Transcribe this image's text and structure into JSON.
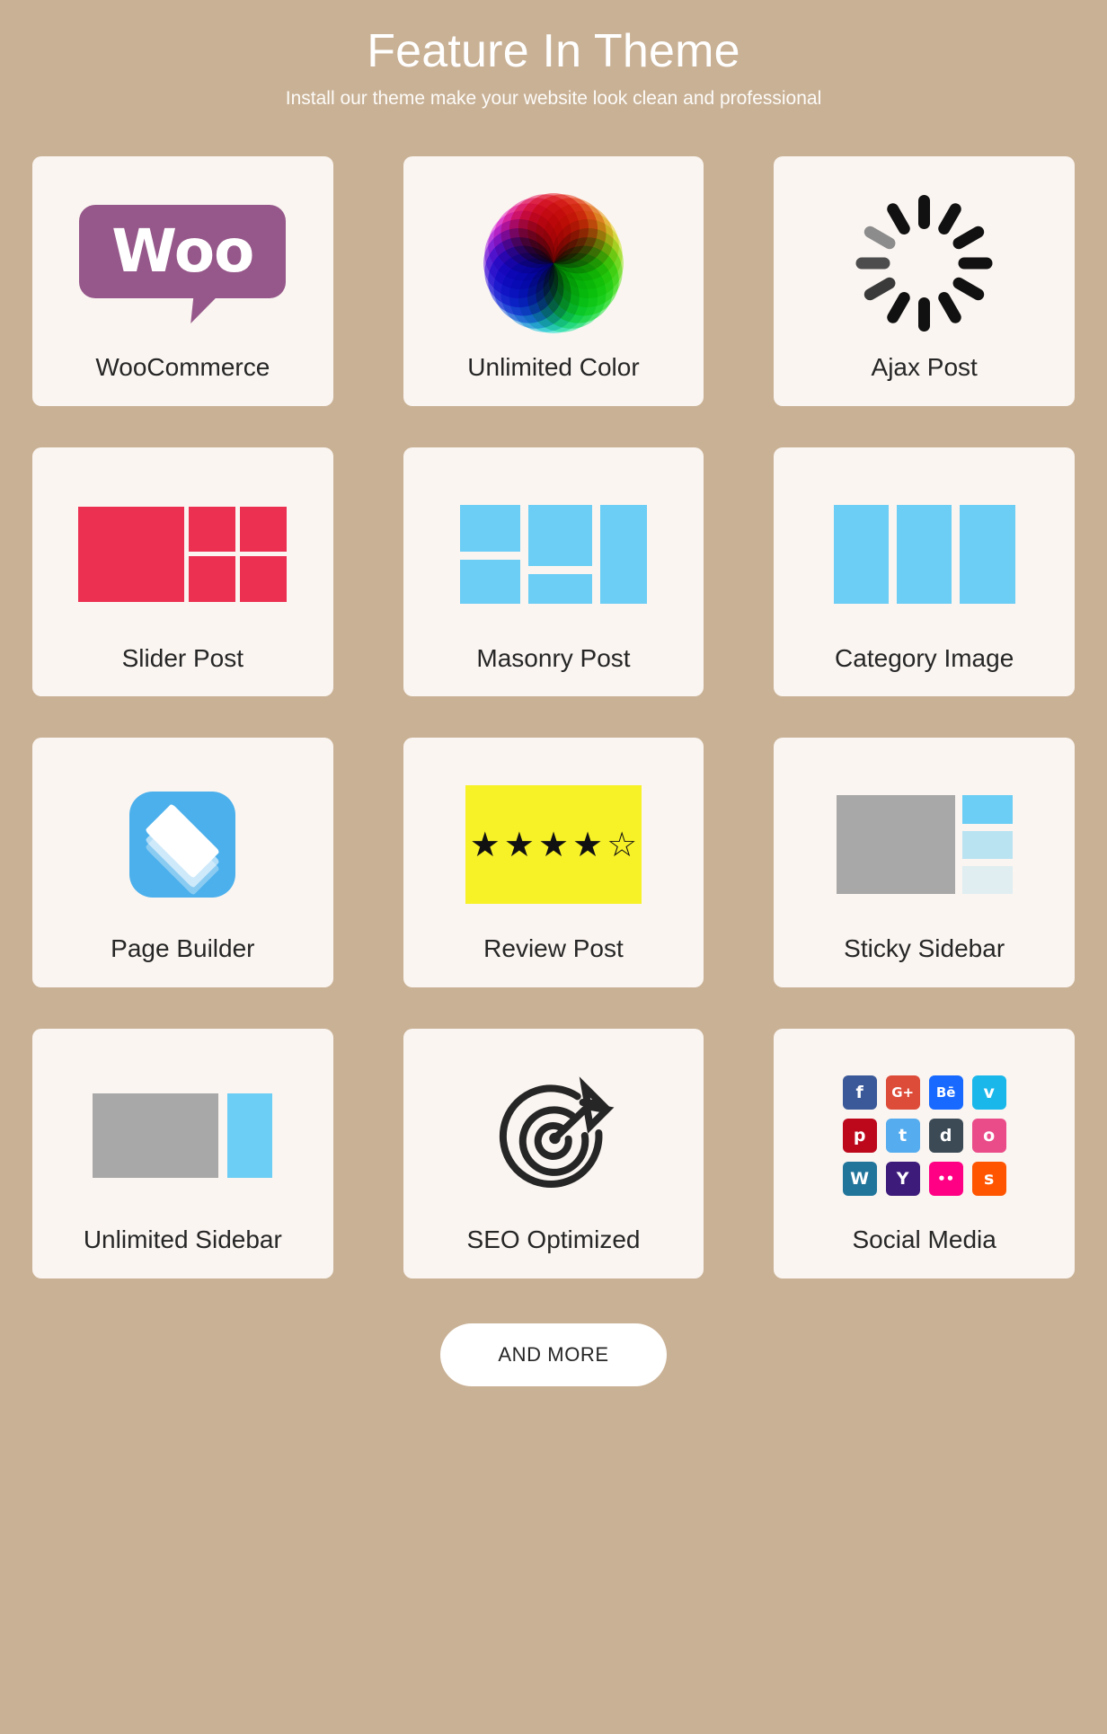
{
  "header": {
    "title": "Feature In Theme",
    "subtitle": "Install our theme make your website look clean and professional"
  },
  "theme": {
    "background": "#c9b195",
    "card_background": "#faf5f1",
    "title_color": "#ffffff",
    "label_color": "#262626",
    "accent_red": "#ec3052",
    "accent_blue": "#6ccef5",
    "accent_gray": "#a8a8a8",
    "accent_yellow": "#f7f128",
    "woo_purple": "#96588a",
    "page_builder_blue": "#4cb0ec"
  },
  "features": [
    {
      "label": "WooCommerce",
      "icon": "woocommerce-logo-icon",
      "woo_text": "Woo"
    },
    {
      "label": "Unlimited Color",
      "icon": "color-wheel-icon"
    },
    {
      "label": "Ajax Post",
      "icon": "loading-spinner-icon"
    },
    {
      "label": "Slider Post",
      "icon": "slider-layout-icon"
    },
    {
      "label": "Masonry Post",
      "icon": "masonry-layout-icon"
    },
    {
      "label": "Category Image",
      "icon": "category-columns-icon"
    },
    {
      "label": "Page Builder",
      "icon": "stacked-layers-icon"
    },
    {
      "label": "Review Post",
      "icon": "star-rating-icon",
      "rating": 4,
      "max_rating": 5
    },
    {
      "label": "Sticky Sidebar",
      "icon": "sticky-sidebar-layout-icon"
    },
    {
      "label": "Unlimited Sidebar",
      "icon": "unlimited-sidebar-layout-icon"
    },
    {
      "label": "SEO Optimized",
      "icon": "target-dartboard-icon"
    },
    {
      "label": "Social Media",
      "icon": "social-icons-grid-icon"
    }
  ],
  "social_icons": [
    {
      "name": "facebook-icon",
      "glyph": "f",
      "color": "#3b5998"
    },
    {
      "name": "google-plus-icon",
      "glyph": "G+",
      "color": "#dd4b39"
    },
    {
      "name": "behance-icon",
      "glyph": "Bē",
      "color": "#1769ff"
    },
    {
      "name": "vimeo-icon",
      "glyph": "v",
      "color": "#1ab7ea"
    },
    {
      "name": "pinterest-icon",
      "glyph": "p",
      "color": "#bd081c"
    },
    {
      "name": "twitter-icon",
      "glyph": "t",
      "color": "#55acee"
    },
    {
      "name": "deviantart-icon",
      "glyph": "d",
      "color": "#3b4a55"
    },
    {
      "name": "dribbble-icon",
      "glyph": "o",
      "color": "#ea4c89"
    },
    {
      "name": "wordpress-icon",
      "glyph": "W",
      "color": "#21759b"
    },
    {
      "name": "yandex-icon",
      "glyph": "Y",
      "color": "#3d1b7a"
    },
    {
      "name": "flickr-icon",
      "glyph": "••",
      "color": "#ff0084"
    },
    {
      "name": "soundcloud-icon",
      "glyph": "s",
      "color": "#ff5500"
    }
  ],
  "footer": {
    "more_label": "AND MORE"
  }
}
